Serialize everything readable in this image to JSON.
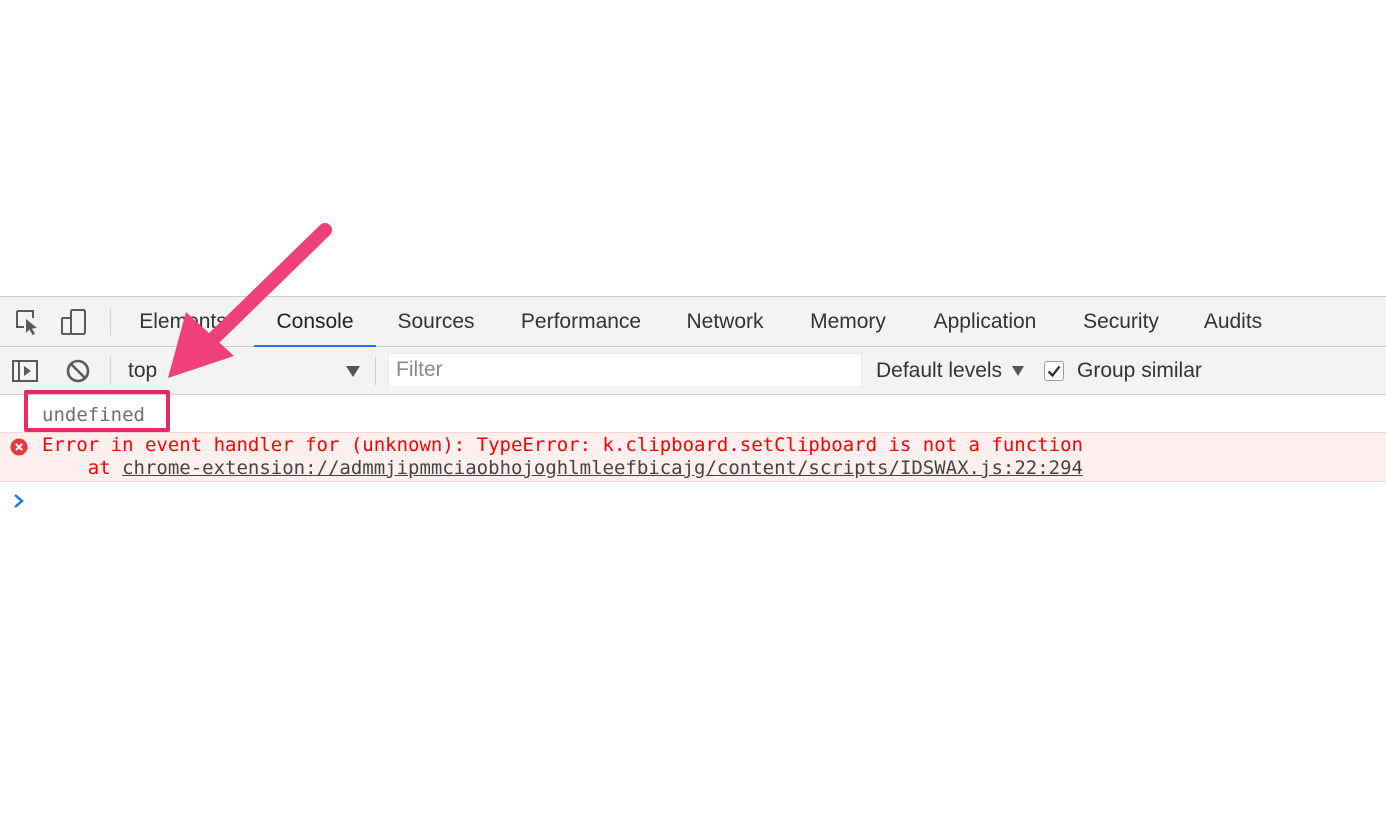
{
  "tabs": [
    {
      "label": "Elements",
      "active": false
    },
    {
      "label": "Console",
      "active": true
    },
    {
      "label": "Sources",
      "active": false
    },
    {
      "label": "Performance",
      "active": false
    },
    {
      "label": "Network",
      "active": false
    },
    {
      "label": "Memory",
      "active": false
    },
    {
      "label": "Application",
      "active": false
    },
    {
      "label": "Security",
      "active": false
    },
    {
      "label": "Audits",
      "active": false
    }
  ],
  "console_toolbar": {
    "context": "top",
    "filter_placeholder": "Filter",
    "levels_label": "Default levels",
    "group_similar_label": "Group similar",
    "group_similar_checked": true
  },
  "messages": {
    "result_text": "undefined",
    "error_line1": "Error in event handler for (unknown): TypeError: k.clipboard.setClipboard is not a function",
    "error_at_prefix": "    at ",
    "error_link": "chrome-extension://admmjipmmciaobhojoghlmleefbicajg/content/scripts/IDSWAX.js:22:294"
  },
  "colors": {
    "annotation": "#e8286b",
    "active_tab_underline": "#1a73e8",
    "error_text": "#ff0000",
    "error_background": "#fff0f0",
    "prompt": "#1a73e8"
  },
  "icons": {
    "inspect": "inspect-element-icon",
    "device": "device-toolbar-icon",
    "sidebar": "show-sidebar-icon",
    "clear": "clear-console-icon",
    "error": "error-circle-icon",
    "prompt": "chevron-right-icon"
  }
}
